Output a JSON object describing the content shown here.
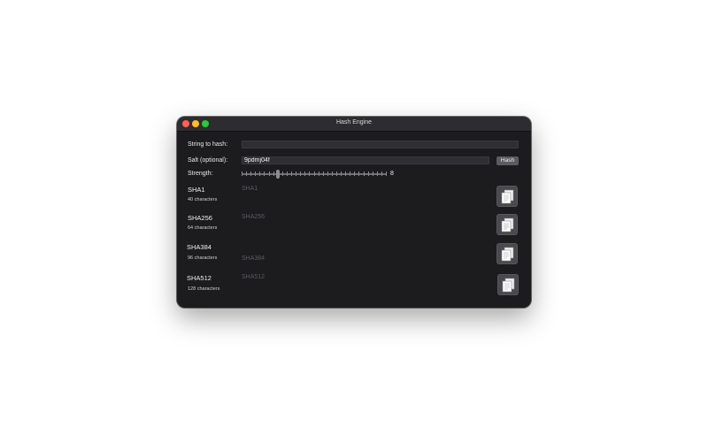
{
  "window": {
    "title": "Hash Engine"
  },
  "form": {
    "string_label": "String to hash:",
    "string_value": "",
    "salt_label": "Salt (optional):",
    "salt_value": "9pdmj04f",
    "hash_button": "Hash",
    "strength_label": "Strength:",
    "strength_value": "8",
    "strength_level": 8
  },
  "results": [
    {
      "name": "SHA1",
      "chars": "40 characters",
      "placeholder": "SHA1"
    },
    {
      "name": "SHA256",
      "chars": "64 characters",
      "placeholder": "SHA256"
    },
    {
      "name": "SHA384",
      "chars": "96 characters",
      "placeholder": "SHA384"
    },
    {
      "name": "SHA512",
      "chars": "128 characters",
      "placeholder": "SHA512"
    }
  ],
  "icons": {
    "traffic_lights": [
      "close-icon",
      "minimize-icon",
      "zoom-icon"
    ],
    "copy": "copy-document-icon"
  },
  "colors": {
    "window_bg": "#1c1b1e",
    "titlebar": "#2d2c30",
    "close": "#ff5f57",
    "minimize": "#febc2e",
    "zoom": "#28c840"
  }
}
